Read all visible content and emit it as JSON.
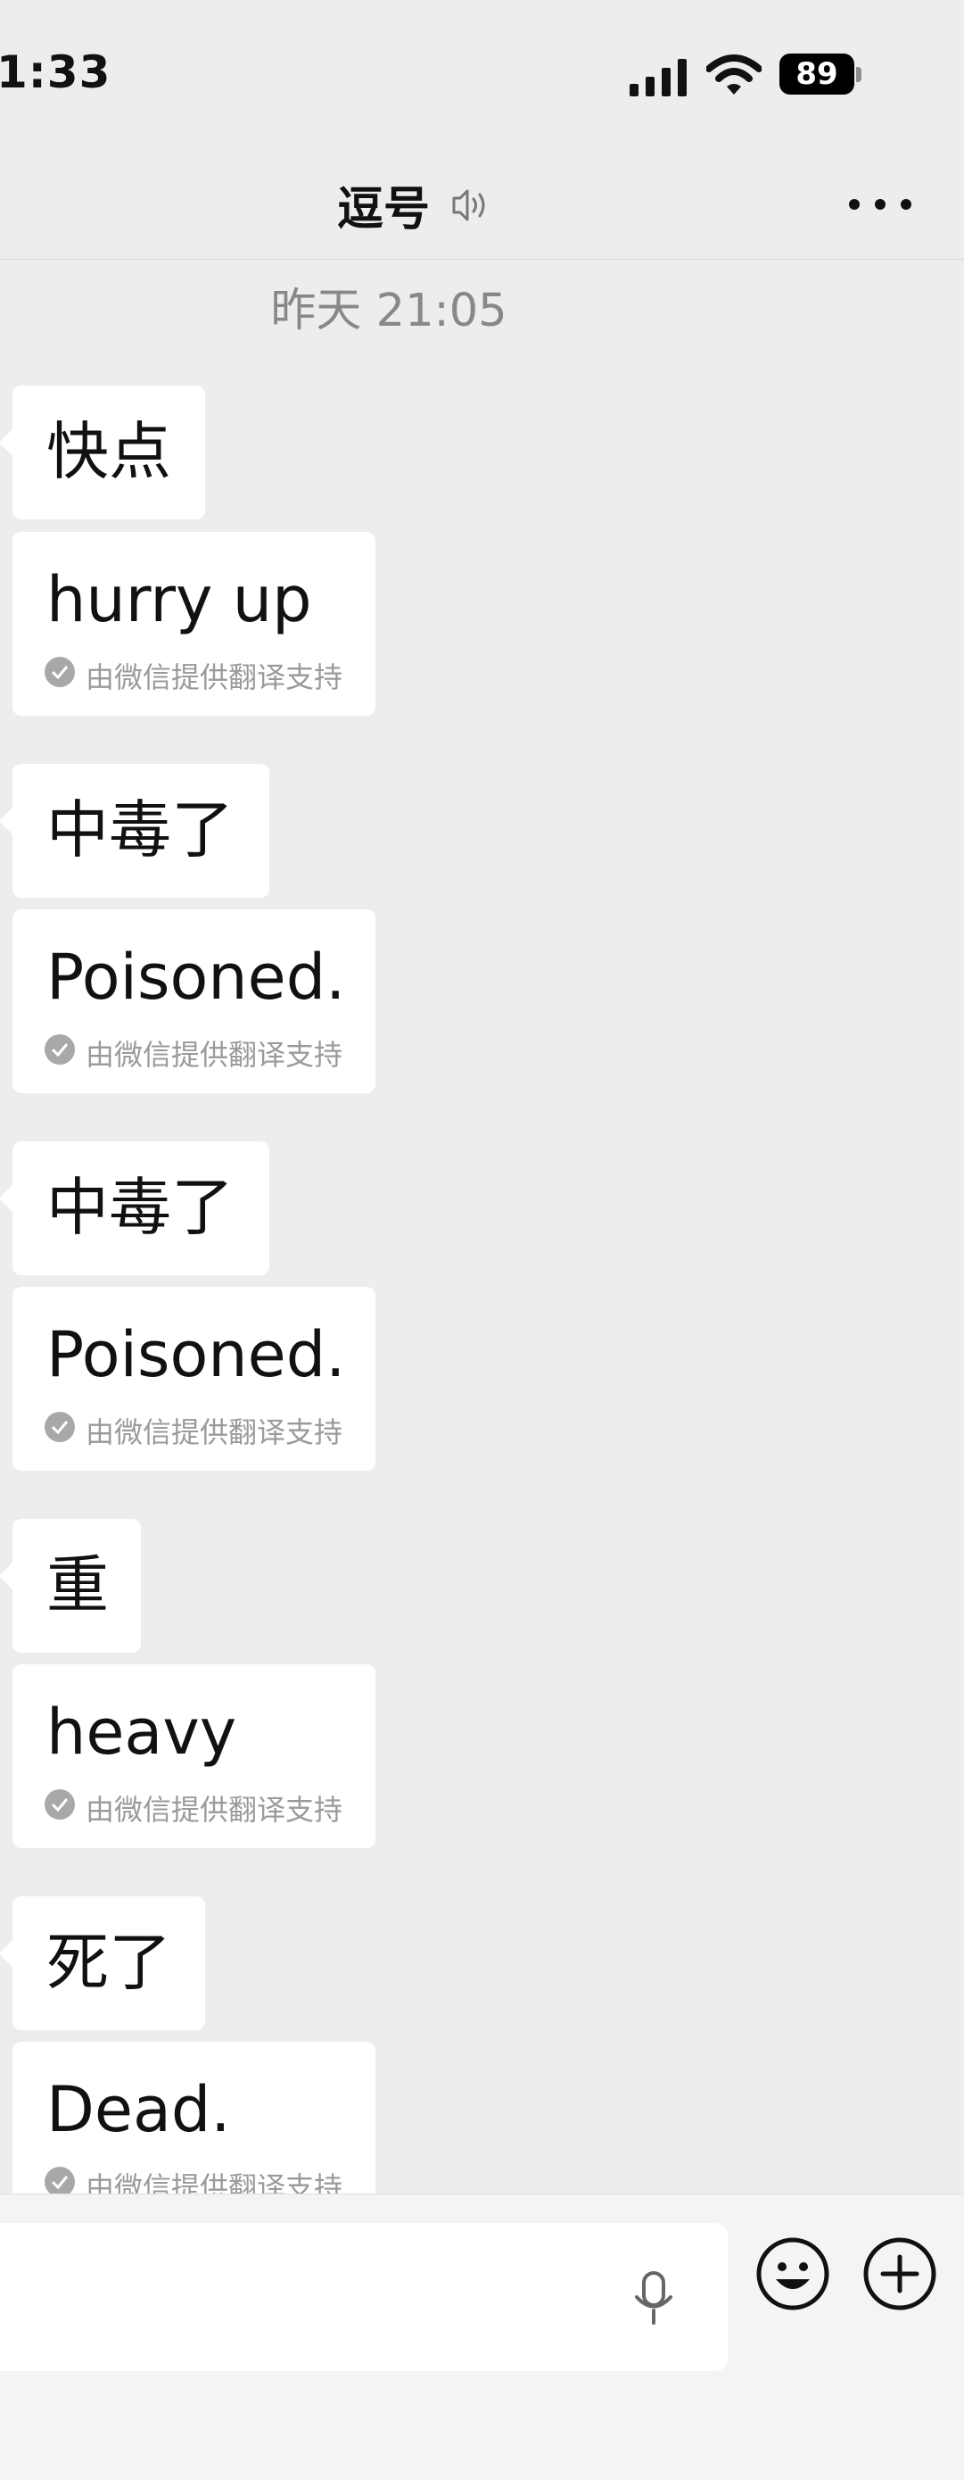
{
  "status": {
    "time": "1:33",
    "battery": "89"
  },
  "header": {
    "title": "逗号",
    "voice_icon": "voice-icon",
    "more_icon": "more-icon"
  },
  "timestamp": "昨天 21:05",
  "messages": [
    {
      "text": "快点",
      "translation": "hurry up",
      "credit": "由微信提供翻译支持"
    },
    {
      "text": "中毒了",
      "translation": "Poisoned.",
      "credit": "由微信提供翻译支持"
    },
    {
      "text": "中毒了",
      "translation": "Poisoned.",
      "credit": "由微信提供翻译支持"
    },
    {
      "text": "重",
      "translation": "heavy",
      "credit": "由微信提供翻译支持"
    },
    {
      "text": "死了",
      "translation": "Dead.",
      "credit": "由微信提供翻译支持"
    }
  ],
  "input": {
    "mic_icon": "microphone-icon",
    "emoji_icon": "emoji-icon",
    "plus_icon": "plus-icon"
  }
}
